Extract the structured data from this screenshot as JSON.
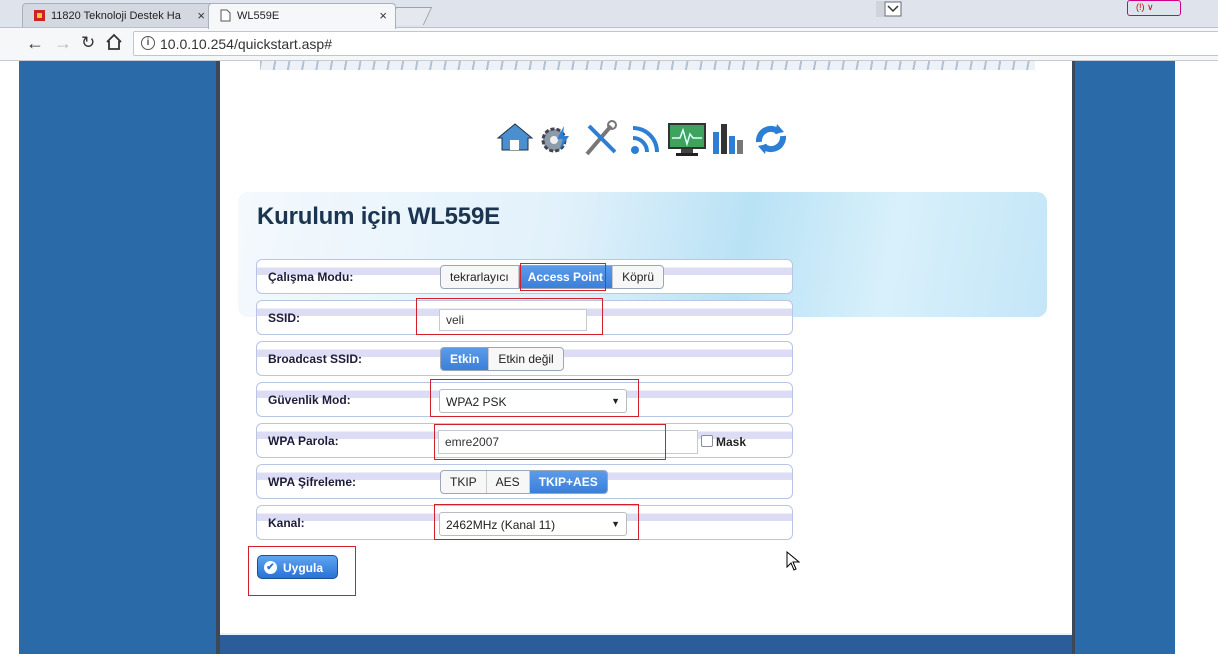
{
  "browser": {
    "tabs": [
      {
        "title": "11820 Teknoloji Destek Ha",
        "close": "×",
        "active": false
      },
      {
        "title": "WL559E",
        "close": "×",
        "active": true
      }
    ],
    "url": "10.0.10.254/quickstart.asp#",
    "info_glyph": "i",
    "extension_badge": "(!) ∨"
  },
  "icons": [
    "home-icon",
    "gear-bolt-icon",
    "tools-icon",
    "wireless-icon",
    "monitor-icon",
    "statistics-icon",
    "refresh-icon"
  ],
  "setup": {
    "title": "Kurulum için WL559E",
    "mode": {
      "label": "Çalışma Modu:",
      "options": [
        "tekrarlayıcı",
        "Access Point",
        "Köprü"
      ],
      "selected": "Access Point"
    },
    "ssid": {
      "label": "SSID:",
      "value": "veli"
    },
    "broadcast": {
      "label": "Broadcast SSID:",
      "options": [
        "Etkin",
        "Etkin değil"
      ],
      "selected": "Etkin"
    },
    "security": {
      "label": "Güvenlik Mod:",
      "value": "WPA2 PSK"
    },
    "passphrase": {
      "label": "WPA Parola:",
      "value": "emre2007",
      "mask_label": "Mask"
    },
    "encryption": {
      "label": "WPA Şifreleme:",
      "options": [
        "TKIP",
        "AES",
        "TKIP+AES"
      ],
      "selected": "TKIP+AES"
    },
    "channel": {
      "label": "Kanal:",
      "value": "2462MHz (Kanal 11)"
    },
    "apply_label": "Uygula"
  },
  "colors": {
    "accent": "#3b7fd8",
    "highlight_box": "#d21f2a",
    "page_background": "#2a6aa9"
  }
}
